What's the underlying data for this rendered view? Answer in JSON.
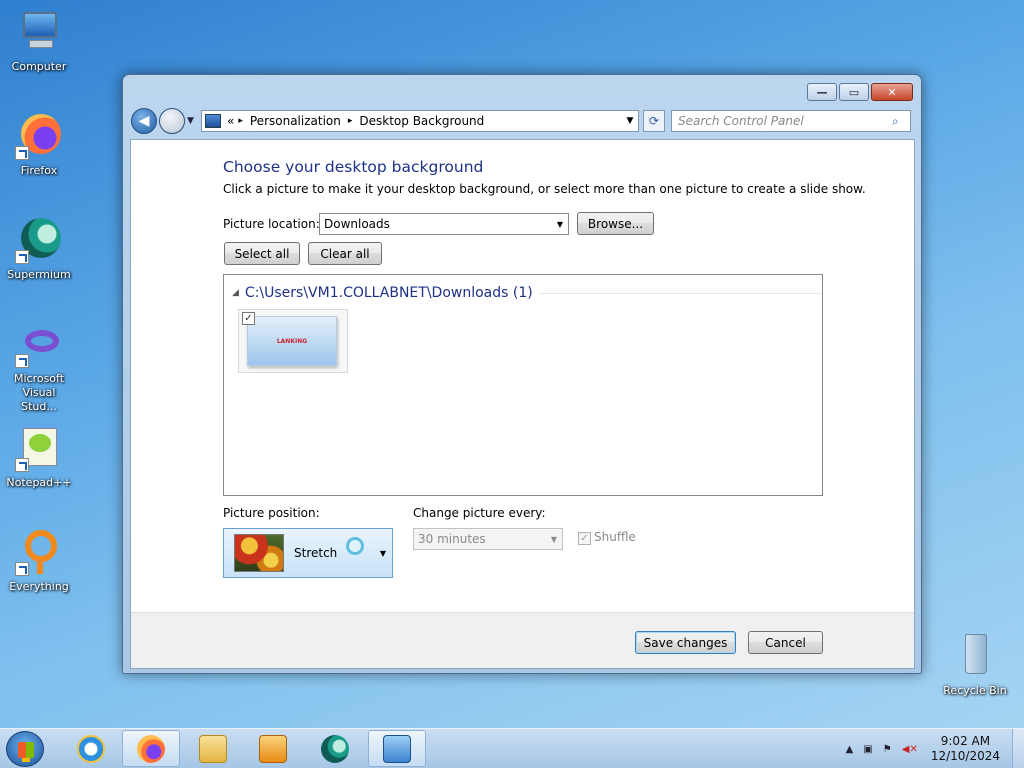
{
  "desktop": {
    "icons": [
      {
        "label": "Computer",
        "icon": "computer-icon"
      },
      {
        "label": "Firefox",
        "icon": "firefox-icon"
      },
      {
        "label": "Supermium",
        "icon": "supermium-icon"
      },
      {
        "label": "Microsoft Visual Stud...",
        "icon": "visual-studio-icon"
      },
      {
        "label": "Notepad++",
        "icon": "notepadpp-icon"
      },
      {
        "label": "Everything",
        "icon": "everything-icon"
      },
      {
        "label": "Recycle Bin",
        "icon": "recycle-bin-icon"
      }
    ]
  },
  "window": {
    "buttons": {
      "minimize": "—",
      "maximize": "▭",
      "close": "✕"
    },
    "breadcrumb": {
      "prefix": "«",
      "items": [
        "Personalization",
        "Desktop Background"
      ],
      "separator": "▸"
    },
    "search_placeholder": "Search Control Panel"
  },
  "page": {
    "title": "Choose your desktop background",
    "description": "Click a picture to make it your desktop background, or select more than one picture to create a slide show.",
    "picture_location_label": "Picture location:",
    "picture_location_value": "Downloads",
    "browse_label": "Browse...",
    "select_all_label": "Select all",
    "clear_all_label": "Clear all",
    "group_header": "C:\\Users\\VM1.COLLABNET\\Downloads (1)",
    "thumbnail": {
      "checked": true,
      "text": "LANKING"
    },
    "picture_position_label": "Picture position:",
    "picture_position_value": "Stretch",
    "change_every_label": "Change picture every:",
    "change_every_value": "30 minutes",
    "shuffle_label": "Shuffle",
    "shuffle_checked": true,
    "save_label": "Save changes",
    "cancel_label": "Cancel"
  },
  "taskbar": {
    "items": [
      "internet-explorer-icon",
      "firefox-icon",
      "file-explorer-icon",
      "media-player-icon",
      "supermium-icon",
      "control-panel-icon"
    ],
    "active_index": 5,
    "tray_arrow": "▲",
    "time": "9:02 AM",
    "date": "12/10/2024"
  }
}
